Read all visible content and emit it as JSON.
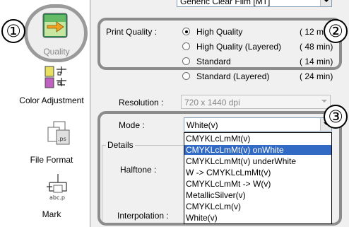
{
  "sidebar": {
    "items": [
      {
        "label": "Quality",
        "icon": "quality-arrow-icon"
      },
      {
        "label": "Color Adjustment",
        "icon": "color-adjustment-icon"
      },
      {
        "label": "File Format",
        "icon": "file-format-icon"
      },
      {
        "label": "Mark",
        "icon": "mark-icon"
      }
    ]
  },
  "callouts": [
    "①",
    "②",
    "③"
  ],
  "media": {
    "value": "Generic Clear Film [MT]"
  },
  "print_quality": {
    "label": "Print Quality :",
    "options": [
      {
        "label": "High Quality",
        "time": "( 12 min)",
        "selected": true
      },
      {
        "label": "High Quality (Layered)",
        "time": "( 48 min)",
        "selected": false
      },
      {
        "label": "Standard",
        "time": "( 14 min)",
        "selected": false
      },
      {
        "label": "Standard (Layered)",
        "time": "( 24 min)",
        "selected": false
      }
    ]
  },
  "resolution": {
    "label": "Resolution :",
    "value": "720 x 1440 dpi"
  },
  "mode": {
    "label": "Mode :",
    "value": "White(v)",
    "options": [
      "CMYKLcLmMt(v)",
      "CMYKLcLmMt(v) onWhite",
      "CMYKLcLmMt(v) underWhite",
      "W -> CMYKLcLmMt(v)",
      "CMYKLcLmMt -> W(v)",
      "MetallicSilver(v)",
      "CMYKLcLm(v)",
      "White(v)"
    ],
    "highlighted_index": 1
  },
  "details": {
    "label": "Details",
    "halftone_label": "Halftone :",
    "interpolation_label": "Interpolation :"
  },
  "colors": {
    "highlight": "#316ac5",
    "callout_ring": "#8c8c8c",
    "panel_bg": "#f0f0f0"
  }
}
